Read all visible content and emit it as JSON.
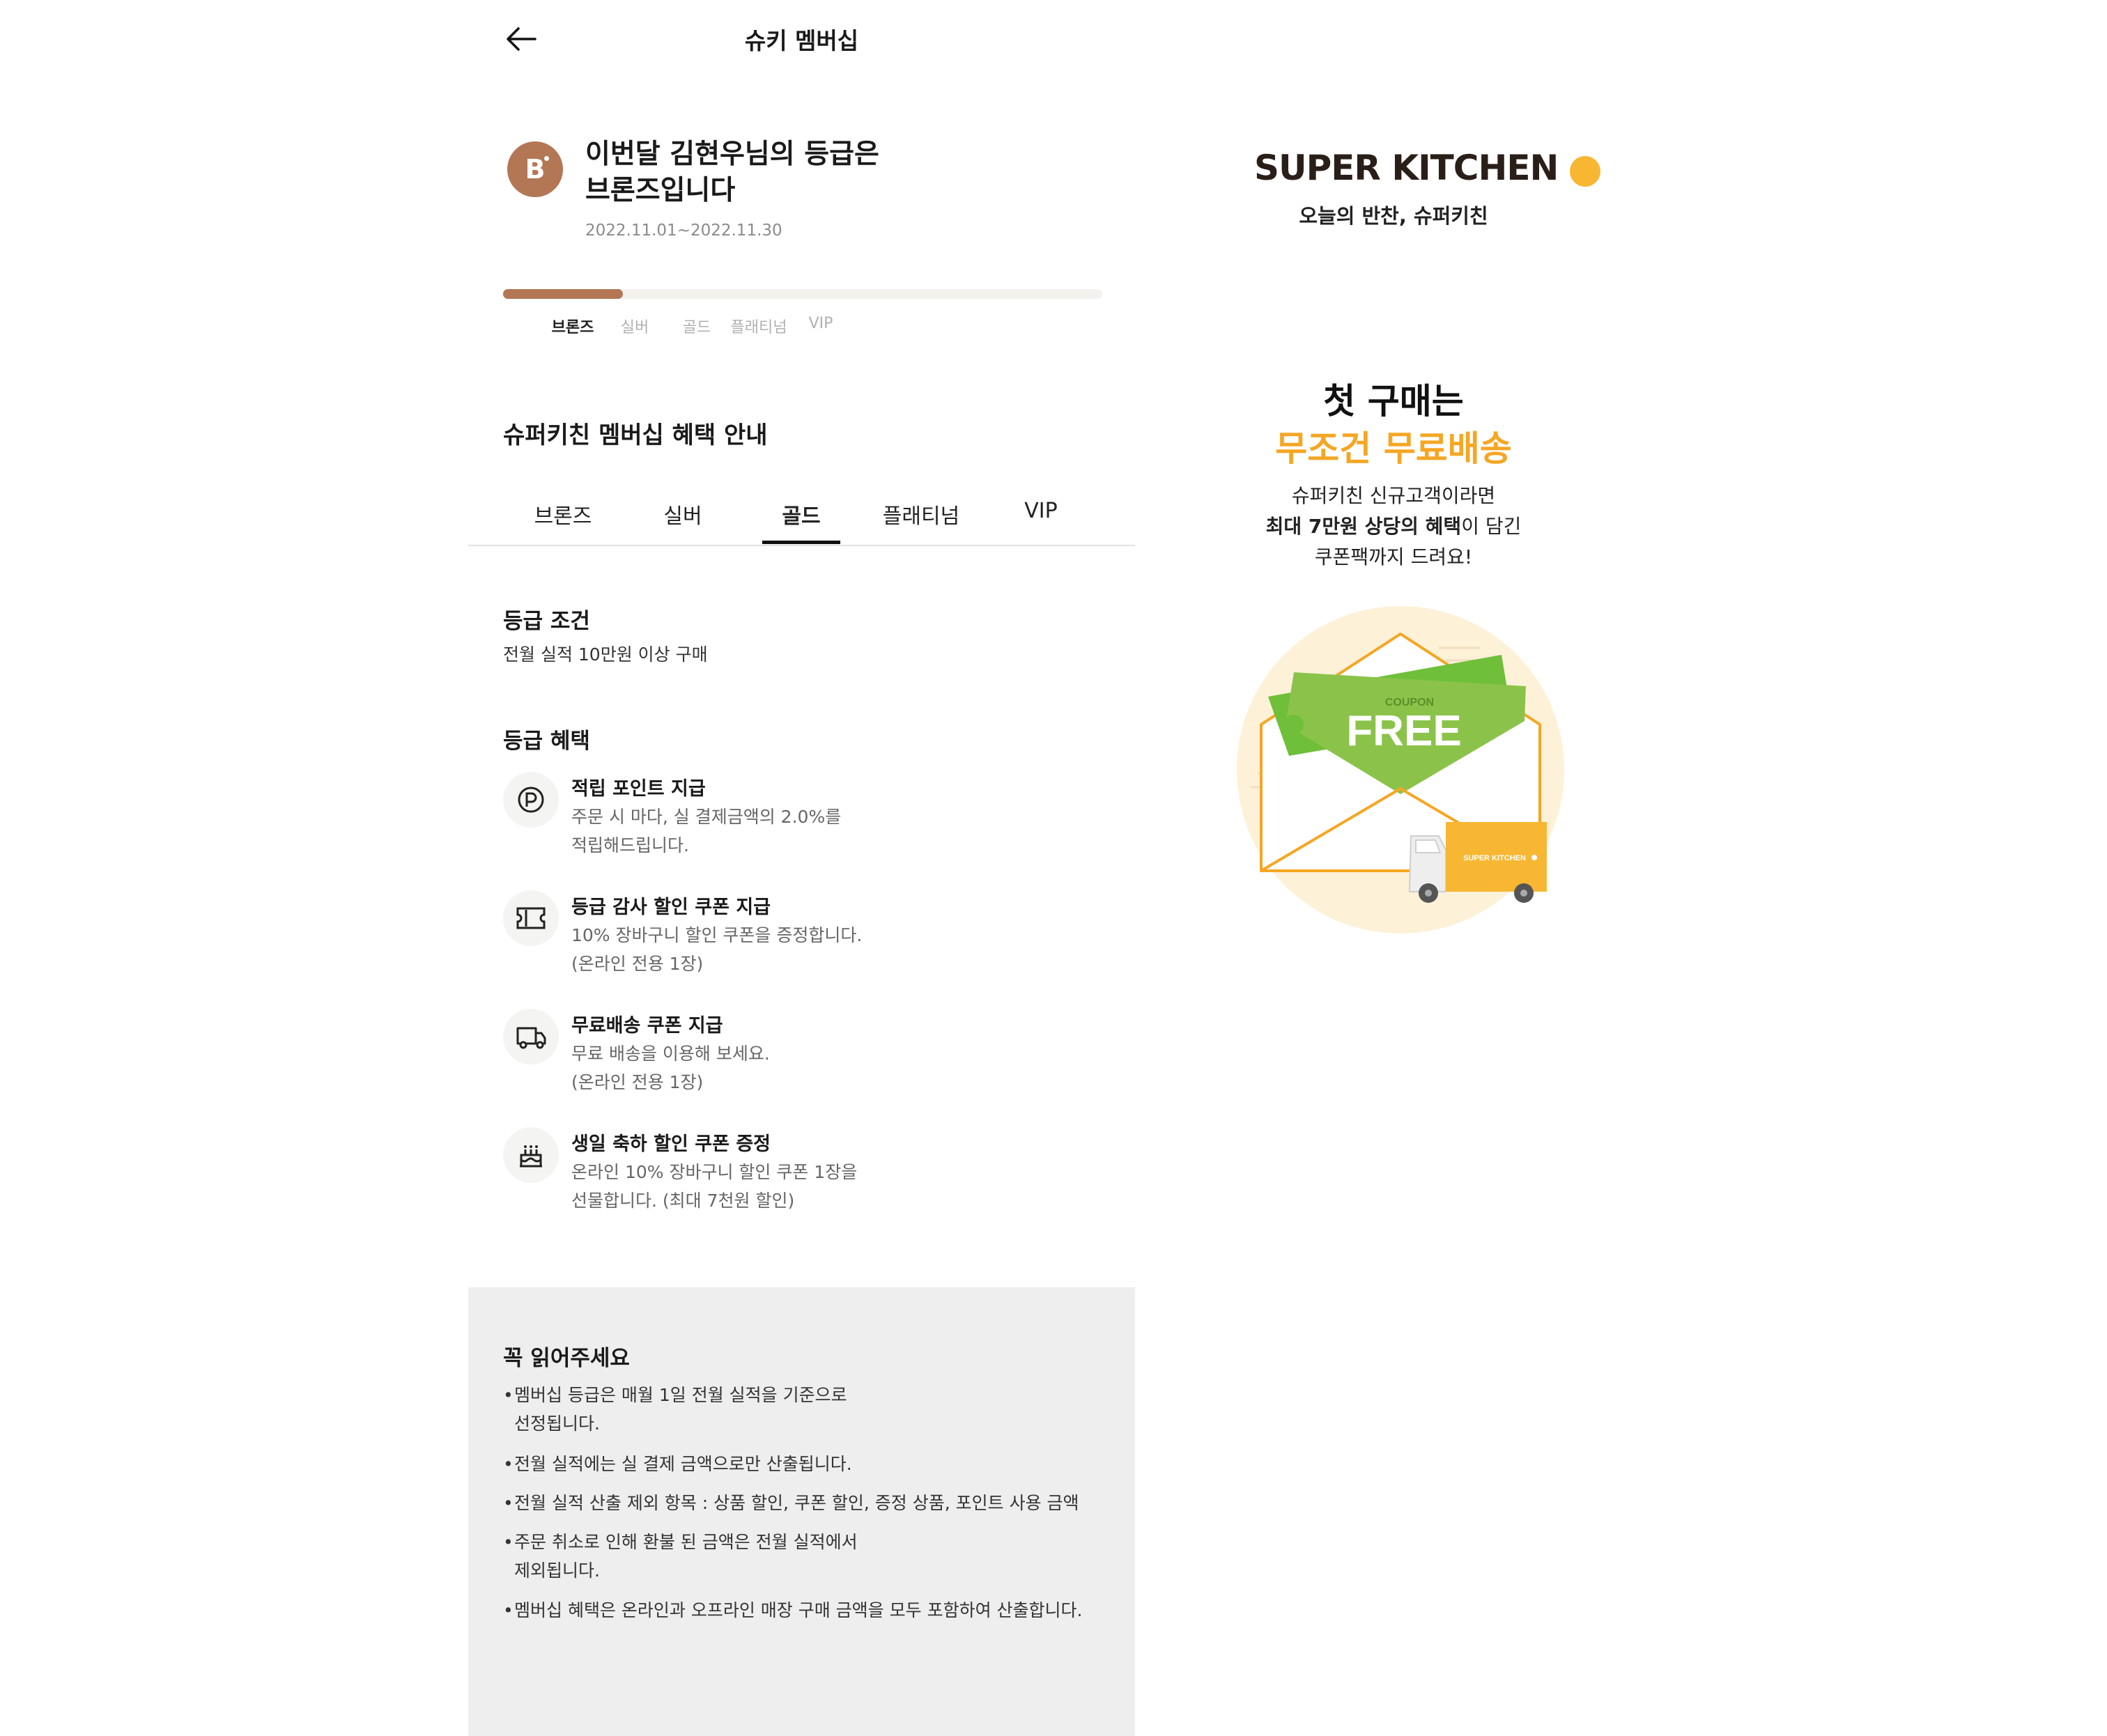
{
  "app": {
    "title": "슈키 멤버십"
  },
  "grade": {
    "badge_letter": "B",
    "message_line1": "이번달 김현우님의 등급은",
    "message_line2": "브론즈입니다",
    "period": "2022.11.01~2022.11.30",
    "progress_fraction": 0.2,
    "steps": [
      "브론즈",
      "실버",
      "골드",
      "플래티넘",
      "VIP"
    ],
    "active_step": 0
  },
  "benefits_section": {
    "title": "슈퍼키친 멤버십 혜택 안내",
    "tabs": [
      "브론즈",
      "실버",
      "골드",
      "플래티넘",
      "VIP"
    ],
    "selected_tab": 2
  },
  "condition": {
    "title": "등급 조건",
    "text": "전월 실적 10만원 이상 구매"
  },
  "benefits": {
    "title": "등급 혜택",
    "items": [
      {
        "icon": "point-icon",
        "title": "적립 포인트 지급",
        "line1": "주문 시 마다, 실 결제금액의 2.0%를",
        "line2": "적립해드립니다."
      },
      {
        "icon": "coupon-icon",
        "title": "등급 감사 할인 쿠폰 지급",
        "line1": "10% 장바구니 할인 쿠폰을 증정합니다.",
        "line2": "(온라인 전용 1장)"
      },
      {
        "icon": "truck-icon",
        "title": "무료배송 쿠폰 지급",
        "line1": "무료 배송을 이용해 보세요.",
        "line2": "(온라인 전용 1장)"
      },
      {
        "icon": "cake-icon",
        "title": "생일 축하 할인 쿠폰 증정",
        "line1": "온라인 10% 장바구니 할인 쿠폰 1장을",
        "line2": "선물합니다. (최대 7천원 할인)"
      }
    ]
  },
  "notice": {
    "title": "꼭 읽어주세요",
    "items": [
      {
        "line1": "멤버십 등급은 매월 1일 전월 실적을 기준으로",
        "line2": "선정됩니다."
      },
      {
        "line1": "전월 실적에는 실 결제 금액으로만 산출됩니다.",
        "line2": ""
      },
      {
        "line1": "전월 실적 산출 제외 항목 : 상품 할인, 쿠폰 할인, 증정 상품, 포인트 사용 금액",
        "line2": ""
      },
      {
        "line1": "주문 취소로 인해 환불 된 금액은 전월 실적에서",
        "line2": "제외됩니다."
      },
      {
        "line1": "멤버십 혜택은 온라인과 오프라인 매장 구매 금액을 모두 포함하여 산출합니다.",
        "line2": ""
      }
    ],
    "bullet": "•"
  },
  "promo": {
    "brand": "SUPER KITCHEN",
    "tagline": "오늘의 반찬, 슈퍼키친",
    "headline1": "첫 구매는",
    "headline2": "무조건 무료배송",
    "desc1": "슈퍼키친 신규고객이라면",
    "desc2_bold": "최대 7만원 상당의 혜택",
    "desc2_rest": "이 담긴",
    "desc3": "쿠폰팩까지 드려요!",
    "coupon_label": "COUPON",
    "coupon_text": "FREE",
    "truck_label": "SUPER KITCHEN"
  },
  "colors": {
    "bronze": "#b37755",
    "accent_orange": "#f5a623",
    "brand_yellow": "#f7b733",
    "coupon_green": "#8bc34a"
  }
}
